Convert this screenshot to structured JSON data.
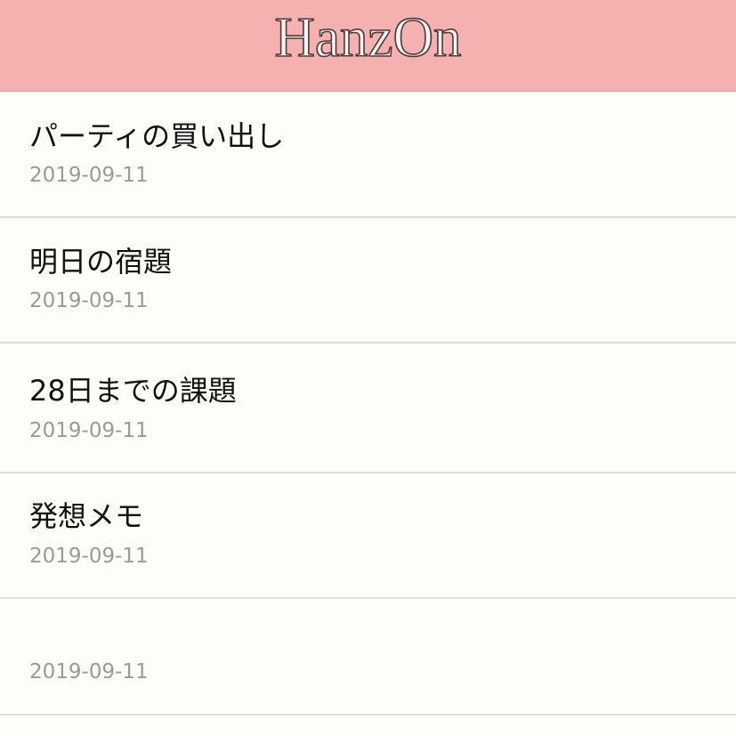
{
  "header": {
    "title": "HanzOn",
    "background_color": "#f5b0b0"
  },
  "memos": [
    {
      "title": "パーティの買い出し",
      "date": "2019-09-11"
    },
    {
      "title": "明日の宿題",
      "date": "2019-09-11"
    },
    {
      "title": "28日までの課題",
      "date": "2019-09-11"
    },
    {
      "title": "発想メモ",
      "date": "2019-09-11"
    },
    {
      "title": "",
      "date": "2019-09-11"
    }
  ],
  "colors": {
    "list_background": "#fefdf8",
    "title_text": "#111111",
    "date_text": "#9a9a9a",
    "divider": "#dcdcdc"
  }
}
